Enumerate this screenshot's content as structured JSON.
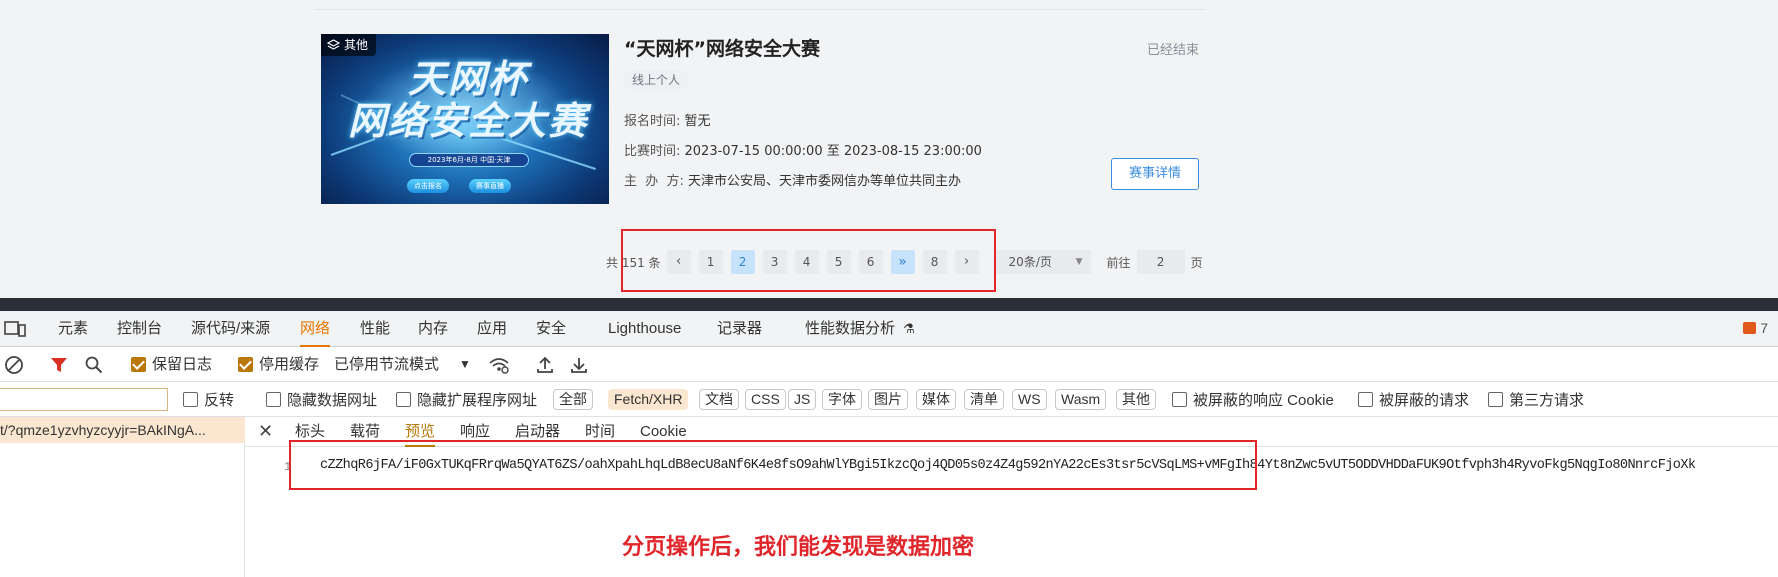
{
  "card": {
    "category_tag": "其他",
    "poster_line1": "天网杯",
    "poster_line2": "网络安全大赛",
    "poster_date": "2023年6月-8月 中国·天津",
    "poster_btn_a": "点击报名",
    "poster_btn_b": "赛事直播",
    "title": "“天网杯”网络安全大赛",
    "status": "已经结束",
    "mode": "线上个人",
    "signup_label": "报名时间: ",
    "signup_value": "暂无",
    "time_label": "比赛时间: ",
    "time_value": "2023-07-15 00:00:00 至 2023-08-15 23:00:00",
    "host_label": "主  办  方: ",
    "host_value": "天津市公安局、天津市委网信办等单位共同主办",
    "detail_button": "赛事详情"
  },
  "pagination": {
    "total_text": "共 151 条",
    "prev": "‹",
    "pages": [
      "1",
      "2",
      "3",
      "4",
      "5",
      "6",
      "»",
      "8"
    ],
    "current_page": "2",
    "next": "›",
    "page_size": "20条/页",
    "goto_label": "前往",
    "goto_value": "2",
    "goto_unit": "页"
  },
  "devtools": {
    "tabs": [
      "元素",
      "控制台",
      "源代码/来源",
      "网络",
      "性能",
      "内存",
      "应用",
      "安全",
      "Lighthouse",
      "记录器",
      "性能数据分析"
    ],
    "selected_tab": "网络",
    "issues_count": "7",
    "toolbar": {
      "preserve_log": "保留日志",
      "disable_cache": "停用缓存",
      "throttling": "已停用节流模式"
    },
    "filter": {
      "invert": "反转",
      "hide_data_urls": "隐藏数据网址",
      "hide_extension_urls": "隐藏扩展程序网址",
      "types": [
        "全部",
        "Fetch/XHR",
        "文档",
        "CSS",
        "JS",
        "字体",
        "图片",
        "媒体",
        "清单",
        "WS",
        "Wasm",
        "其他"
      ],
      "selected_type": "Fetch/XHR",
      "blocked_cookies": "被屏蔽的响应 Cookie",
      "blocked_requests": "被屏蔽的请求",
      "third_party": "第三方请求"
    },
    "request_name": "t/?qmze1yzvhyzcyyjr=BAkINgA...",
    "detail_tabs": [
      "标头",
      "载荷",
      "预览",
      "响应",
      "启动器",
      "时间",
      "Cookie"
    ],
    "selected_detail_tab": "预览",
    "line_number": "1",
    "response_text": "cZZhqR6jFA/iF0GxTUKqFRrqWa5QYAT6ZS/oahXpahLhqLdB8ecU8aNf6K4e8fsO9ahWlYBgi5IkzcQoj4QD05s0z4Z4g592nYA22cEs3tsr5cVSqLMS+vMFgIh84Yt8nZwc5vUT5ODDVHDDaFUK9Otfvph3h4RyvoFkg5NqgIo80NnrcFjoXk"
  },
  "annotation": "分页操作后，我们能发现是数据加密"
}
